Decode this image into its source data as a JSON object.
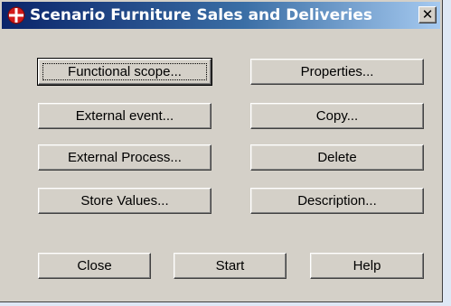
{
  "window": {
    "title": "Scenario Furniture Sales and Deliveries",
    "close_glyph": "✕"
  },
  "buttons": {
    "functional_scope": "Functional scope...",
    "properties": "Properties...",
    "external_event": "External event...",
    "copy": "Copy...",
    "external_process": "External Process...",
    "delete": "Delete",
    "store_values": "Store Values...",
    "description": "Description...",
    "close": "Close",
    "start": "Start",
    "help": "Help"
  },
  "colors": {
    "title_bar_start": "#0a246a",
    "title_bar_end": "#a6caf0",
    "dialog_face": "#d4d0c8",
    "icon_red": "#d21a1a"
  }
}
